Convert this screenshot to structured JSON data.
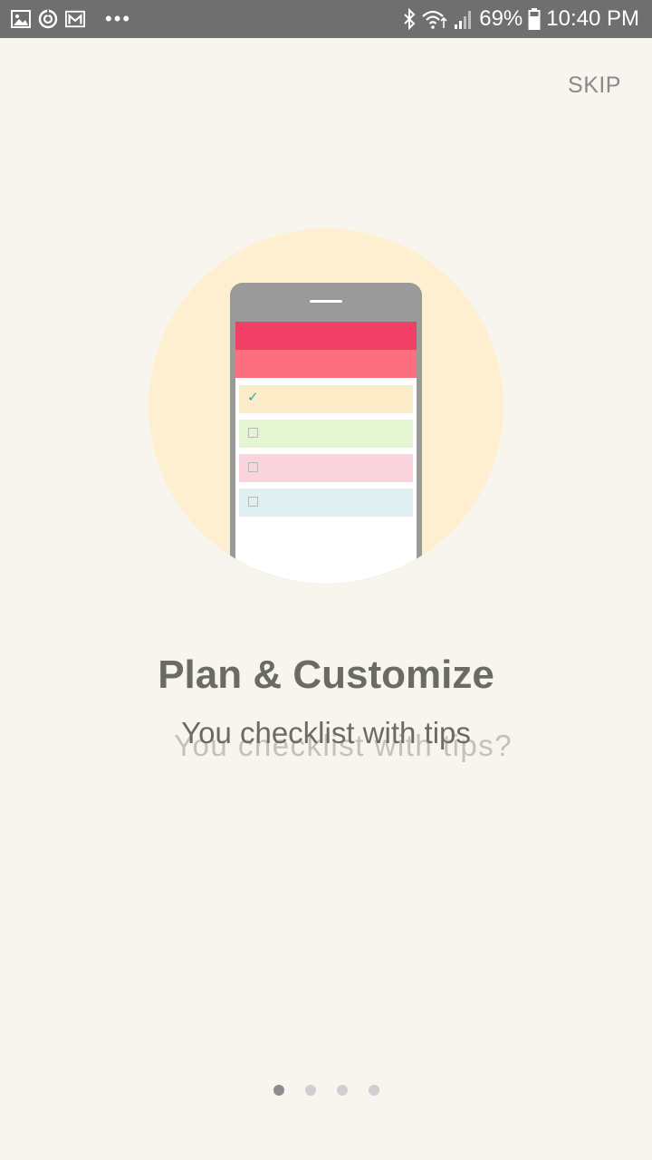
{
  "status_bar": {
    "notification_icons": [
      "image-icon",
      "sync-icon",
      "mail-icon"
    ],
    "more_dots": "•••",
    "battery_percent": "69%",
    "time": "10:40 PM"
  },
  "skip_label": "SKIP",
  "onboarding": {
    "title": "Plan & Customize",
    "subtitle": "You checklist with tips",
    "subtitle_ghost": "You checklist with tips?"
  },
  "illustration": {
    "circle_color": "#fdefcf",
    "phone_color": "#9a9a9a",
    "header_colors": [
      "#ef3f66",
      "#fb6f7e"
    ],
    "checklist_rows": [
      {
        "color": "#fcecc7",
        "checked": true,
        "check_glyph": "✓"
      },
      {
        "color": "#e3f5d1",
        "checked": false
      },
      {
        "color": "#fad4dc",
        "checked": false
      },
      {
        "color": "#e0f0f2",
        "checked": false
      }
    ]
  },
  "pagination": {
    "total": 4,
    "current": 1
  }
}
